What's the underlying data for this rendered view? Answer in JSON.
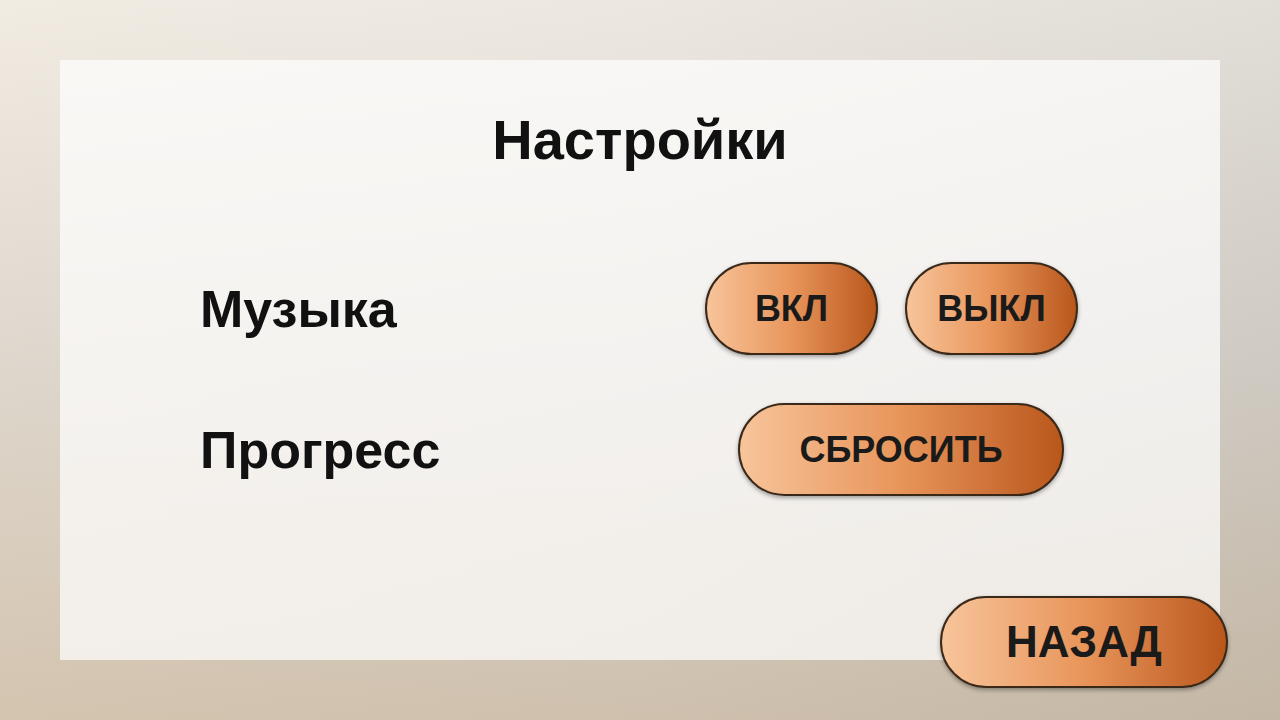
{
  "screen": {
    "title": "Настройки"
  },
  "rows": [
    {
      "label": "Музыка",
      "buttons": [
        "ВКЛ",
        "ВЫКЛ"
      ]
    },
    {
      "label": "Прогресс",
      "buttons": [
        "СБРОСИТЬ"
      ]
    }
  ],
  "back_button": "НАЗАД"
}
